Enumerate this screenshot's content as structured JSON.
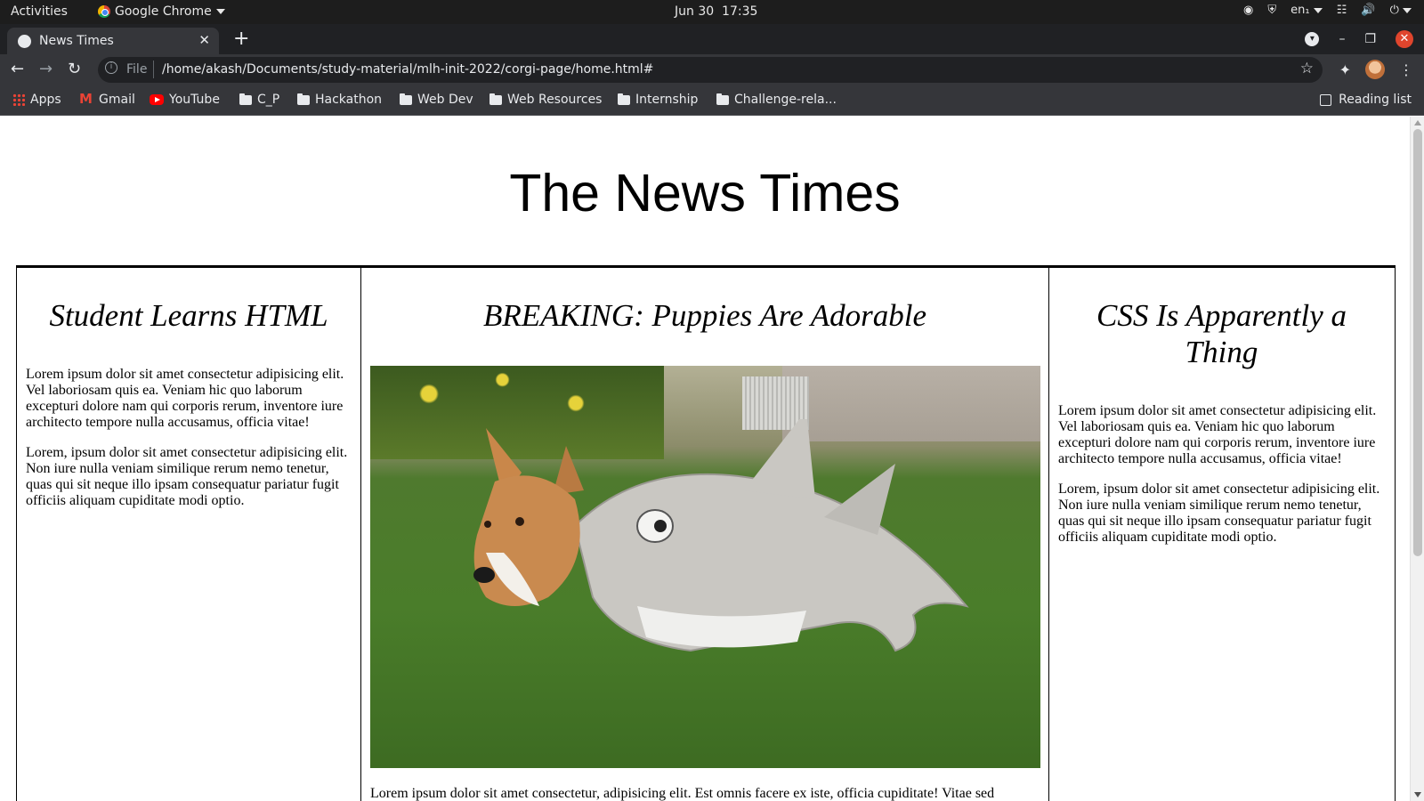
{
  "os": {
    "activities": "Activities",
    "app_name": "Google Chrome",
    "clock": "Jun 30  17:35",
    "lang": "en₁"
  },
  "browser": {
    "tab_title": "News Times",
    "url_scheme": "File",
    "url": "/home/akash/Documents/study-material/mlh-init-2022/corgi-page/home.html#",
    "bookmarks": [
      "Apps",
      "Gmail",
      "YouTube",
      "C_P",
      "Hackathon",
      "Web Dev",
      "Web Resources",
      "Internship",
      "Challenge-rela..."
    ],
    "reading_list": "Reading list"
  },
  "page": {
    "title": "The News Times",
    "col1": {
      "heading": "Student Learns HTML",
      "p1": "Lorem ipsum dolor sit amet consectetur adipisicing elit. Vel laboriosam quis ea. Veniam hic quo laborum excepturi dolore nam qui corporis rerum, inventore iure architecto tempore nulla accusamus, officia vitae!",
      "p2": "Lorem, ipsum dolor sit amet consectetur adipisicing elit. Non iure nulla veniam similique rerum nemo tenetur, quas qui sit neque illo ipsam consequatur pariatur fugit officiis aliquam cupiditate modi optio."
    },
    "col2": {
      "heading": "BREAKING: Puppies Are Adorable",
      "caption": "Lorem ipsum dolor sit amet consectetur, adipisicing elit. Est omnis facere ex iste, officia cupiditate! Vitae sed"
    },
    "col3": {
      "heading": "CSS Is Apparently a Thing",
      "p1": "Lorem ipsum dolor sit amet consectetur adipisicing elit. Vel laboriosam quis ea. Veniam hic quo laborum excepturi dolore nam qui corporis rerum, inventore iure architecto tempore nulla accusamus, officia vitae!",
      "p2": "Lorem, ipsum dolor sit amet consectetur adipisicing elit. Non iure nulla veniam similique rerum nemo tenetur, quas qui sit neque illo ipsam consequatur pariatur fugit officiis aliquam cupiditate modi optio."
    }
  }
}
